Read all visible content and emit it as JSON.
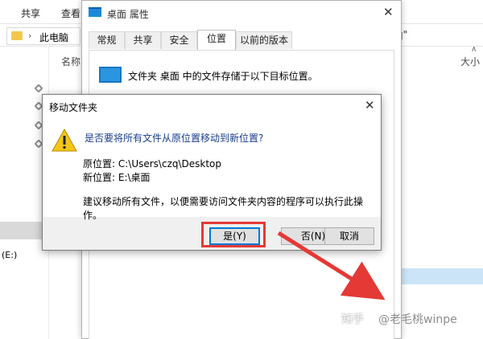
{
  "explorer": {
    "ribbon_tabs": [
      "共享",
      "查看"
    ],
    "address_text": "此电脑",
    "search_fragment": "q\"",
    "column_name": "名称",
    "column_size": "大小",
    "drive_label": "(E:)"
  },
  "properties_window": {
    "title": "桌面 属性",
    "tabs": [
      "常规",
      "共享",
      "安全",
      "位置",
      "以前的版本"
    ],
    "active_tab": "位置",
    "location_description": "文件夹 桌面 中的文件存储于以下目标位置。"
  },
  "move_dialog": {
    "title": "移动文件夹",
    "question": "是否要将所有文件从原位置移动到新位置?",
    "original_location": "原位置: C:\\Users\\czq\\Desktop",
    "new_location": "新位置: E:\\桌面",
    "advice": "建议移动所有文件，以便需要访问文件夹内容的程序可以执行此操作。",
    "buttons": {
      "yes": "是(Y)",
      "no": "否(N)",
      "cancel": "取消"
    }
  },
  "watermark": {
    "brand": "知乎",
    "user": "@老毛桃winpe"
  },
  "colors": {
    "accent_blue": "#0078d7",
    "annotation_red": "#e53935",
    "warning_yellow": "#f5c518"
  }
}
